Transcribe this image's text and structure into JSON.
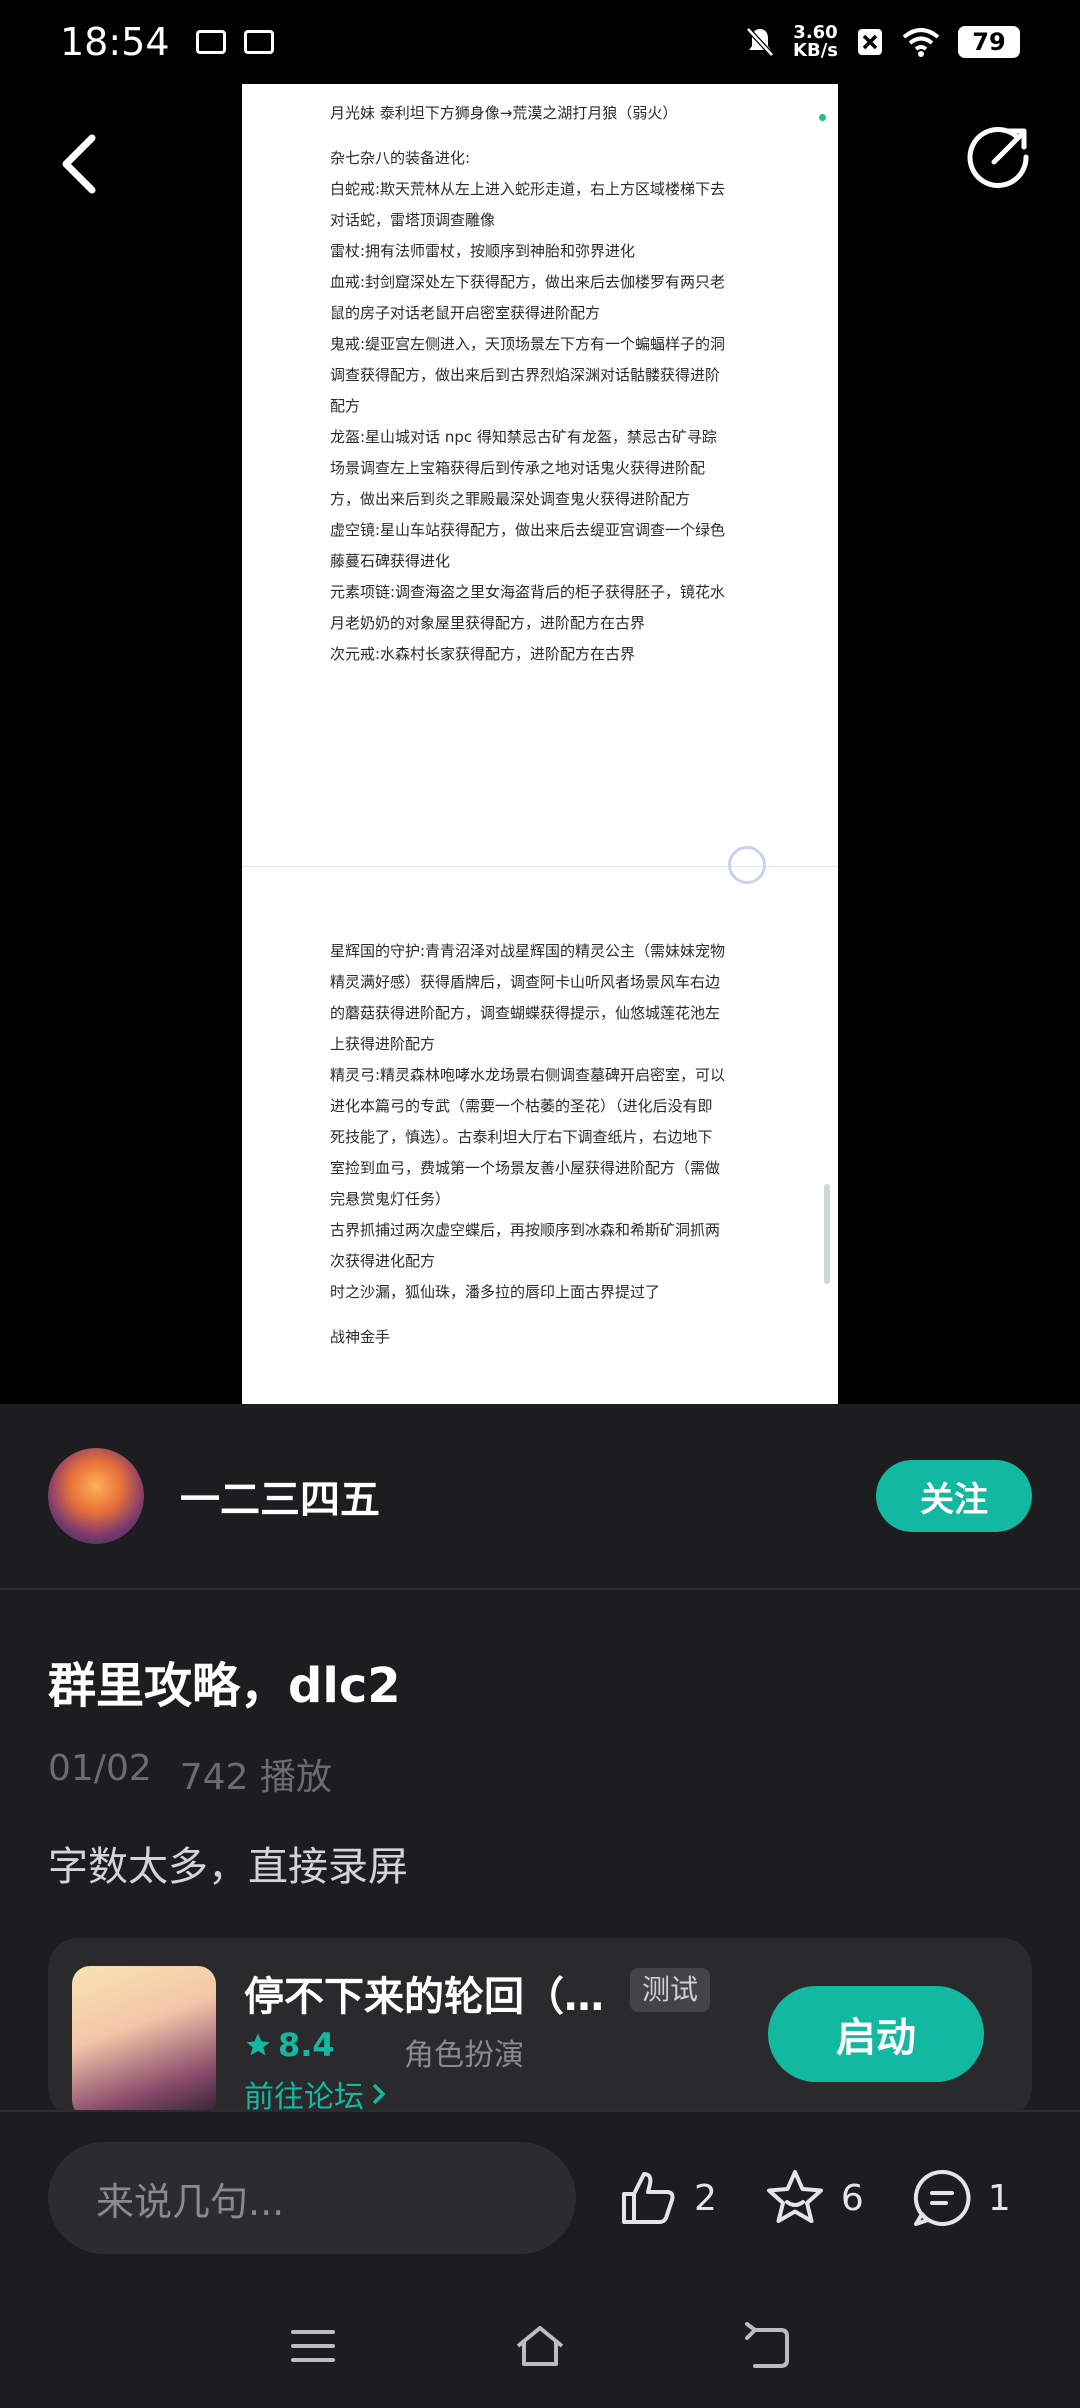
{
  "status_bar": {
    "time": "18:54",
    "net_speed_value": "3.60",
    "net_speed_unit": "KB/s",
    "battery": "79"
  },
  "document": {
    "lines": [
      "月光妹  泰利坦下方狮身像→荒漠之湖打月狼（弱火）",
      "",
      "杂七杂八的装备进化:",
      "白蛇戒:欺天荒林从左上进入蛇形走道，右上方区域楼梯下去",
      "对话蛇，雷塔顶调查雕像",
      "雷杖:拥有法师雷杖，按顺序到神胎和弥界进化",
      "血戒:封剑窟深处左下获得配方，做出来后去伽楼罗有两只老",
      "鼠的房子对话老鼠开启密室获得进阶配方",
      "鬼戒:缇亚宫左侧进入，天顶场景左下方有一个蝙蝠样子的洞",
      "调查获得配方，做出来后到古界烈焰深渊对话骷髅获得进阶",
      "配方",
      "龙盔:星山城对话 npc 得知禁忌古矿有龙盔，禁忌古矿寻踪",
      "场景调查左上宝箱获得后到传承之地对话鬼火获得进阶配",
      "方，做出来后到炎之罪殿最深处调查鬼火获得进阶配方",
      "虚空镜:星山车站获得配方，做出来后去缇亚宫调查一个绿色",
      "藤蔓石碑获得进化",
      "元素项链:调查海盗之里女海盗背后的柜子获得胚子，镜花水",
      "月老奶奶的对象屋里获得配方，进阶配方在古界",
      "次元戒:水森村长家获得配方，进阶配方在古界"
    ],
    "lines_page2": [
      "星辉国的守护:青青沼泽对战星辉国的精灵公主（需妹妹宠物",
      "精灵满好感）获得盾牌后，调查阿卡山听风者场景风车右边",
      "的蘑菇获得进阶配方，调查蝴蝶获得提示，仙悠城莲花池左",
      "上获得进阶配方",
      "精灵弓:精灵森林咆哮水龙场景右侧调查墓碑开启密室，可以",
      "进化本篇弓的专武（需要一个枯萎的圣花）（进化后没有即",
      "死技能了，慎选）。古泰利坦大厅右下调查纸片，右边地下",
      "室捡到血弓，费城第一个场景友善小屋获得进阶配方（需做",
      "完悬赏鬼灯任务）",
      "古界抓捕过两次虚空蝶后，再按顺序到冰森和希斯矿洞抓两",
      "次获得进化配方",
      "时之沙漏，狐仙珠，潘多拉的唇印上面古界提过了",
      "",
      "战神金手"
    ]
  },
  "author": {
    "name": "一二三四五",
    "follow_label": "关注"
  },
  "post": {
    "title": "群里攻略，dlc2",
    "date": "01/02",
    "views": "742 播放",
    "body": "字数太多，直接录屏"
  },
  "game": {
    "name": "停不下来的轮回（…",
    "tag": "测试",
    "rating": "8.4",
    "genre": "角色扮演",
    "forum_link": "前往论坛",
    "launch_label": "启动"
  },
  "actions": {
    "comment_placeholder": "来说几句...",
    "likes": "2",
    "favorites": "6",
    "comments": "1"
  },
  "colors": {
    "accent": "#13b8a0",
    "sheet_bg": "#1d1d1f"
  }
}
